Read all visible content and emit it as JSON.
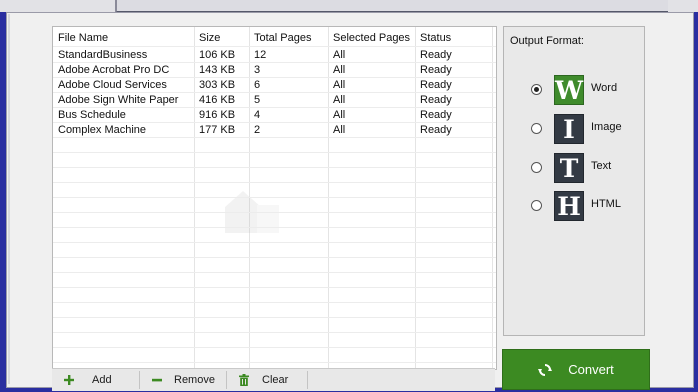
{
  "table": {
    "columns": [
      "File Name",
      "Size",
      "Total Pages",
      "Selected Pages",
      "Status"
    ],
    "rows": [
      [
        "StandardBusiness",
        "106 KB",
        "12",
        "All",
        "Ready"
      ],
      [
        "Adobe Acrobat Pro DC",
        "143 KB",
        "3",
        "All",
        "Ready"
      ],
      [
        "Adobe Cloud Services",
        "303 KB",
        "6",
        "All",
        "Ready"
      ],
      [
        "Adobe Sign White Paper",
        "416 KB",
        "5",
        "All",
        "Ready"
      ],
      [
        "Bus Schedule",
        "916 KB",
        "4",
        "All",
        "Ready"
      ],
      [
        "Complex Machine",
        "177 KB",
        "2",
        "All",
        "Ready"
      ]
    ]
  },
  "toolbar": {
    "add_label": "Add",
    "remove_label": "Remove",
    "clear_label": "Clear"
  },
  "output_format": {
    "title": "Output Format:",
    "options": [
      {
        "letter": "W",
        "label": "Word",
        "selected": true,
        "icon": "word-icon"
      },
      {
        "letter": "I",
        "label": "Image",
        "selected": false,
        "icon": "image-icon"
      },
      {
        "letter": "T",
        "label": "Text",
        "selected": false,
        "icon": "text-icon"
      },
      {
        "letter": "H",
        "label": "HTML",
        "selected": false,
        "icon": "html-icon"
      }
    ]
  },
  "convert": {
    "label": "Convert"
  },
  "colors": {
    "accent_green": "#3c8a22",
    "word_tile": "#3f8b2c",
    "dark_tile": "#333a44",
    "background": "#2a2ea0"
  }
}
